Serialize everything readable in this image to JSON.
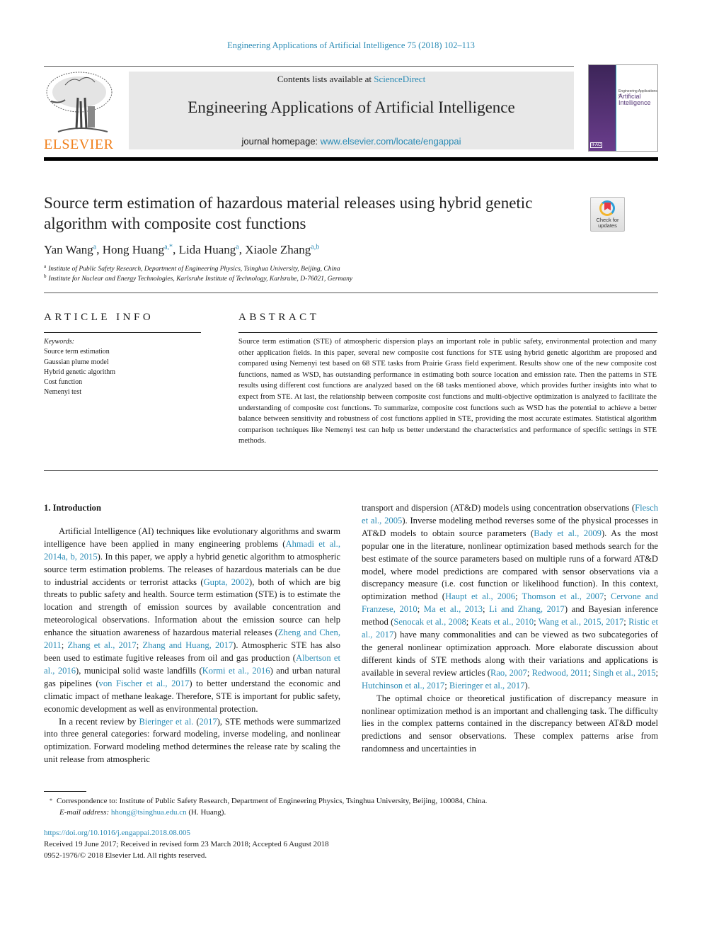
{
  "header": {
    "citation": "Engineering Applications of Artificial Intelligence 75 (2018) 102–113",
    "contents_prefix": "Contents lists available at ",
    "contents_link": "ScienceDirect",
    "journal_title": "Engineering Applications of Artificial Intelligence",
    "homepage_prefix": "journal homepage: ",
    "homepage_link": "www.elsevier.com/locate/engappai",
    "publisher_logo_text": "ELSEVIER",
    "cover": {
      "line1": "Engineering Applications of",
      "line2a": "Artificial",
      "line2b": "Intelligence",
      "ifac": "IFAC"
    },
    "brand_color": "#f07f1a",
    "link_color": "#2a8bb5"
  },
  "article": {
    "title": "Source term estimation of hazardous material releases using hybrid genetic algorithm with composite cost functions",
    "crossmark_label": "Check for updates",
    "authors": [
      {
        "name": "Yan Wang",
        "sup": "a"
      },
      {
        "name": "Hong Huang",
        "sup": "a,*"
      },
      {
        "name": "Lida Huang",
        "sup": "a"
      },
      {
        "name": "Xiaole Zhang",
        "sup": "a,b"
      }
    ],
    "affiliations": [
      {
        "mark": "a",
        "text": "Institute of Public Safety Research, Department of Engineering Physics, Tsinghua University, Beijing, China"
      },
      {
        "mark": "b",
        "text": "Institute for Nuclear and Energy Technologies, Karlsruhe Institute of Technology, Karlsruhe, D-76021, Germany"
      }
    ]
  },
  "article_info": {
    "heading": "ARTICLE INFO",
    "keywords_label": "Keywords:",
    "keywords": [
      "Source term estimation",
      "Gaussian plume model",
      "Hybrid genetic algorithm",
      "Cost function",
      "Nemenyi test"
    ]
  },
  "abstract": {
    "heading": "ABSTRACT",
    "text": "Source term estimation (STE) of atmospheric dispersion plays an important role in public safety, environmental protection and many other application fields. In this paper, several new composite cost functions for STE using hybrid genetic algorithm are proposed and compared using Nemenyi test based on 68 STE tasks from Prairie Grass field experiment. Results show one of the new composite cost functions, named as WSD, has outstanding performance in estimating both source location and emission rate. Then the patterns in STE results using different cost functions are analyzed based on the 68 tasks mentioned above, which provides further insights into what to expect from STE. At last, the relationship between composite cost functions and multi-objective optimization is analyzed to facilitate the understanding of composite cost functions. To summarize, composite cost functions such as WSD has the potential to achieve a better balance between sensitivity and robustness of cost functions applied in STE, providing the most accurate estimates. Statistical algorithm comparison techniques like Nemenyi test can help us better understand the characteristics and performance of specific settings in STE methods."
  },
  "body": {
    "section_heading": "1.  Introduction",
    "left_paragraphs": [
      [
        {
          "t": "Artificial Intelligence (AI) techniques like evolutionary algorithms and swarm intelligence have been applied in many engineering problems ("
        },
        {
          "l": "Ahmadi et al., 2014a, b, 2015"
        },
        {
          "t": "). In this paper, we apply a hybrid genetic algorithm to atmospheric source term estimation problems. The releases of hazardous materials can be due to industrial accidents or terrorist attacks ("
        },
        {
          "l": "Gupta, 2002"
        },
        {
          "t": "), both of which are big threats to public safety and health. Source term estimation (STE) is to estimate the location and strength of emission sources by available concentration and meteorological observations. Information about the emission source can help enhance the situation awareness of hazardous material releases ("
        },
        {
          "l": "Zheng and Chen, 2011"
        },
        {
          "t": "; "
        },
        {
          "l": "Zhang et al., 2017"
        },
        {
          "t": "; "
        },
        {
          "l": "Zhang and Huang, 2017"
        },
        {
          "t": "). Atmospheric STE has also been used to estimate fugitive releases from oil and gas production ("
        },
        {
          "l": "Albertson et al., 2016"
        },
        {
          "t": "), municipal solid waste landfills ("
        },
        {
          "l": "Kormi et al., 2016"
        },
        {
          "t": ") and urban natural gas pipelines ("
        },
        {
          "l": "von Fischer et al., 2017"
        },
        {
          "t": ") to better understand the economic and climatic impact of methane leakage. Therefore, STE is important for public safety, economic development as well as environmental protection."
        }
      ],
      [
        {
          "t": "In a recent review by "
        },
        {
          "l": "Bieringer et al."
        },
        {
          "t": " ("
        },
        {
          "l": "2017"
        },
        {
          "t": "), STE methods were summarized into three general categories: forward modeling, inverse modeling, and nonlinear optimization. Forward modeling method determines the release rate by scaling the unit release from atmospheric"
        }
      ]
    ],
    "right_paragraphs": [
      [
        {
          "t": "transport and dispersion (AT&D) models using concentration observations ("
        },
        {
          "l": "Flesch et al., 2005"
        },
        {
          "t": "). Inverse modeling method reverses some of the physical processes in AT&D models to obtain source parameters ("
        },
        {
          "l": "Bady et al., 2009"
        },
        {
          "t": "). As the most popular one in the literature, nonlinear optimization based methods search for the best estimate of the source parameters based on multiple runs of a forward AT&D model, where model predictions are compared with sensor observations via a discrepancy measure (i.e. cost function or likelihood function). In this context, optimization method ("
        },
        {
          "l": "Haupt et al., 2006"
        },
        {
          "t": "; "
        },
        {
          "l": "Thomson et al., 2007"
        },
        {
          "t": "; "
        },
        {
          "l": "Cervone and Franzese, 2010"
        },
        {
          "t": "; "
        },
        {
          "l": "Ma et al., 2013"
        },
        {
          "t": "; "
        },
        {
          "l": "Li and Zhang, 2017"
        },
        {
          "t": ") and Bayesian inference method ("
        },
        {
          "l": "Senocak et al., 2008"
        },
        {
          "t": "; "
        },
        {
          "l": "Keats et al., 2010"
        },
        {
          "t": "; "
        },
        {
          "l": "Wang et al., 2015, 2017"
        },
        {
          "t": "; "
        },
        {
          "l": "Ristic et al., 2017"
        },
        {
          "t": ") have many commonalities and can be viewed as two subcategories of the general nonlinear optimization approach. More elaborate discussion about different kinds of STE methods along with their variations and applications is available in several review articles ("
        },
        {
          "l": "Rao, 2007"
        },
        {
          "t": "; "
        },
        {
          "l": "Redwood, 2011"
        },
        {
          "t": "; "
        },
        {
          "l": "Singh et al., 2015"
        },
        {
          "t": "; "
        },
        {
          "l": "Hutchinson et al., 2017"
        },
        {
          "t": "; "
        },
        {
          "l": "Bieringer et al., 2017"
        },
        {
          "t": ")."
        }
      ],
      [
        {
          "t": "The optimal choice or theoretical justification of discrepancy measure in nonlinear optimization method is an important and challenging task. The difficulty lies in the complex patterns contained in the discrepancy between AT&D model predictions and sensor observations. These complex patterns arise from randomness and uncertainties in"
        }
      ]
    ]
  },
  "footnote": {
    "star": "*",
    "correspondence": "Correspondence to: Institute of Public Safety Research, Department of Engineering Physics, Tsinghua University, Beijing, 100084, China.",
    "email_label": "E-mail address:",
    "email": "hhong@tsinghua.edu.cn",
    "email_suffix": " (H. Huang)."
  },
  "meta": {
    "doi": "https://doi.org/10.1016/j.engappai.2018.08.005",
    "received": "Received 19 June 2017; Received in revised form 23 March 2018; Accepted 6 August 2018",
    "copyright": "0952-1976/© 2018 Elsevier Ltd. All rights reserved."
  }
}
